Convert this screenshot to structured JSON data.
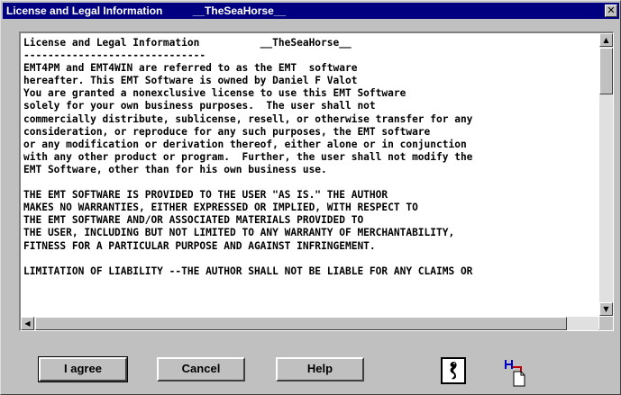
{
  "window": {
    "title": "License and Legal Information          __TheSeaHorse__",
    "close_glyph": "✕"
  },
  "license_lines": [
    "License and Legal Information          __TheSeaHorse__",
    "------------------------------",
    "EMT4PM and EMT4WIN are referred to as the EMT  software",
    "hereafter. This EMT Software is owned by Daniel F Valot",
    "You are granted a nonexclusive license to use this EMT Software",
    "solely for your own business purposes.  The user shall not",
    "commercially distribute, sublicense, resell, or otherwise transfer for any",
    "consideration, or reproduce for any such purposes, the EMT software",
    "or any modification or derivation thereof, either alone or in conjunction",
    "with any other product or program.  Further, the user shall not modify the",
    "EMT Software, other than for his own business use.",
    "",
    "THE EMT SOFTWARE IS PROVIDED TO THE USER \"AS IS.\" THE AUTHOR",
    "MAKES NO WARRANTIES, EITHER EXPRESSED OR IMPLIED, WITH RESPECT TO",
    "THE EMT SOFTWARE AND/OR ASSOCIATED MATERIALS PROVIDED TO",
    "THE USER, INCLUDING BUT NOT LIMITED TO ANY WARRANTY OF MERCHANTABILITY,",
    "FITNESS FOR A PARTICULAR PURPOSE AND AGAINST INFRINGEMENT.",
    "",
    "LIMITATION OF LIABILITY --THE AUTHOR SHALL NOT BE LIABLE FOR ANY CLAIMS OR"
  ],
  "scrollbars": {
    "up_glyph": "▲",
    "down_glyph": "▼",
    "left_glyph": "◀",
    "right_glyph": "▶"
  },
  "buttons": {
    "agree_label": "I agree",
    "cancel_label": "Cancel",
    "help_label": "Help"
  },
  "icons": {
    "seahorse": "seahorse-icon",
    "bitmap": "bitmap-icon"
  }
}
